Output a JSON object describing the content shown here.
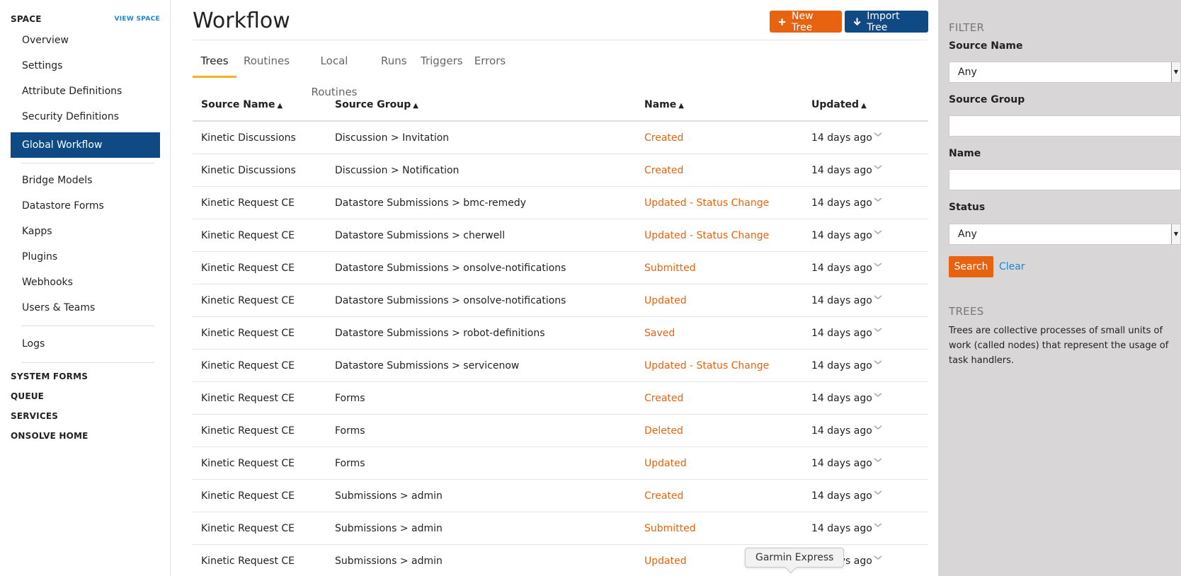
{
  "sidebar": {
    "space_heading": "SPACE",
    "view_space": "VIEW SPACE",
    "items": [
      {
        "label": "Overview"
      },
      {
        "label": "Settings"
      },
      {
        "label": "Attribute Definitions"
      },
      {
        "label": "Security Definitions"
      },
      {
        "label": "Global Workflow",
        "active": true
      },
      {
        "label": "Bridge Models"
      },
      {
        "label": "Datastore Forms"
      },
      {
        "label": "Kapps"
      },
      {
        "label": "Plugins"
      },
      {
        "label": "Webhooks"
      },
      {
        "label": "Users & Teams"
      },
      {
        "label": "Logs"
      }
    ],
    "sections": [
      "SYSTEM FORMS",
      "QUEUE",
      "SERVICES",
      "ONSOLVE HOME"
    ]
  },
  "header": {
    "title": "Workflow",
    "new_tree": "New Tree",
    "import_tree": "Import Tree",
    "new_icon": "plus-icon",
    "import_icon": "arrow-down-icon"
  },
  "tabs": [
    "Trees",
    "Routines",
    "Local Routines",
    "Runs",
    "Triggers",
    "Errors"
  ],
  "active_tab": "Trees",
  "table": {
    "columns": [
      "Source Name",
      "Source Group",
      "Name",
      "Updated"
    ],
    "rows": [
      [
        "Kinetic Discussions",
        "Discussion > Invitation",
        "Created",
        "14 days ago"
      ],
      [
        "Kinetic Discussions",
        "Discussion > Notification",
        "Created",
        "14 days ago"
      ],
      [
        "Kinetic Request CE",
        "Datastore Submissions > bmc-remedy",
        "Updated - Status Change",
        "14 days ago"
      ],
      [
        "Kinetic Request CE",
        "Datastore Submissions > cherwell",
        "Updated - Status Change",
        "14 days ago"
      ],
      [
        "Kinetic Request CE",
        "Datastore Submissions > onsolve-notifications",
        "Submitted",
        "14 days ago"
      ],
      [
        "Kinetic Request CE",
        "Datastore Submissions > onsolve-notifications",
        "Updated",
        "14 days ago"
      ],
      [
        "Kinetic Request CE",
        "Datastore Submissions > robot-definitions",
        "Saved",
        "14 days ago"
      ],
      [
        "Kinetic Request CE",
        "Datastore Submissions > servicenow",
        "Updated - Status Change",
        "14 days ago"
      ],
      [
        "Kinetic Request CE",
        "Forms",
        "Created",
        "14 days ago"
      ],
      [
        "Kinetic Request CE",
        "Forms",
        "Deleted",
        "14 days ago"
      ],
      [
        "Kinetic Request CE",
        "Forms",
        "Updated",
        "14 days ago"
      ],
      [
        "Kinetic Request CE",
        "Submissions > admin",
        "Created",
        "14 days ago"
      ],
      [
        "Kinetic Request CE",
        "Submissions > admin",
        "Submitted",
        "14 days ago"
      ],
      [
        "Kinetic Request CE",
        "Submissions > admin",
        "Updated",
        "14 days ago"
      ]
    ]
  },
  "filter": {
    "title": "FILTER",
    "source_name_label": "Source Name",
    "source_name_value": "Any",
    "source_group_label": "Source Group",
    "name_label": "Name",
    "status_label": "Status",
    "status_value": "Any",
    "search": "Search",
    "clear": "Clear",
    "trees_title": "TREES",
    "trees_desc": "Trees are collective processes of small units of work (called nodes) that represent the usage of task handlers."
  },
  "tooltip": "Garmin Express",
  "colors": {
    "accent_orange": "#e8630f",
    "nav_blue": "#0f4a84",
    "link_blue": "#1f84d6",
    "tab_underline": "#f0b323",
    "filter_bg": "#d8d6d6"
  }
}
